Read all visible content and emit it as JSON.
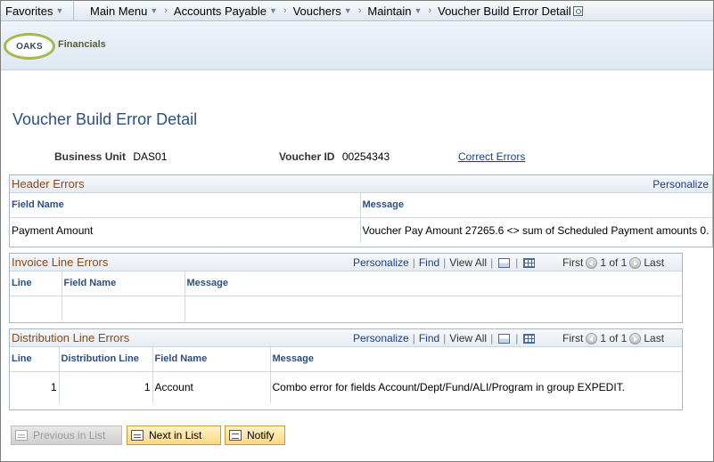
{
  "nav": {
    "favorites": "Favorites",
    "crumbs": [
      "Main Menu",
      "Accounts Payable",
      "Vouchers",
      "Maintain",
      "Voucher Build Error Detail"
    ]
  },
  "banner": {
    "logo": "OAKS",
    "product": "Financials"
  },
  "page": {
    "title": "Voucher Build Error Detail",
    "business_unit_label": "Business Unit",
    "business_unit_value": "DAS01",
    "voucher_id_label": "Voucher ID",
    "voucher_id_value": "00254343",
    "correct_errors": "Correct Errors"
  },
  "header_errors": {
    "title": "Header Errors",
    "personalize": "Personalize",
    "columns": [
      "Field Name",
      "Message"
    ],
    "rows": [
      [
        "Payment Amount",
        "Voucher Pay Amount 27265.6 <> sum of Scheduled Payment amounts 0."
      ]
    ]
  },
  "invoice_line_errors": {
    "title": "Invoice Line Errors",
    "personalize": "Personalize",
    "find": "Find",
    "view_all": "View All",
    "first": "First",
    "pager": "1 of 1",
    "last": "Last",
    "columns": [
      "Line",
      "Field Name",
      "Message"
    ],
    "rows": [
      [
        "",
        "",
        ""
      ]
    ]
  },
  "distribution_line_errors": {
    "title": "Distribution Line Errors",
    "personalize": "Personalize",
    "find": "Find",
    "view_all": "View All",
    "first": "First",
    "pager": "1 of 1",
    "last": "Last",
    "columns": [
      "Line",
      "Distribution Line",
      "Field Name",
      "Message"
    ],
    "rows": [
      [
        "1",
        "1",
        "Account",
        "Combo error for fields Account/Dept/Fund/ALI/Program in group EXPEDIT."
      ]
    ]
  },
  "buttons": {
    "previous": "Previous in List",
    "next": "Next in List",
    "notify": "Notify"
  }
}
